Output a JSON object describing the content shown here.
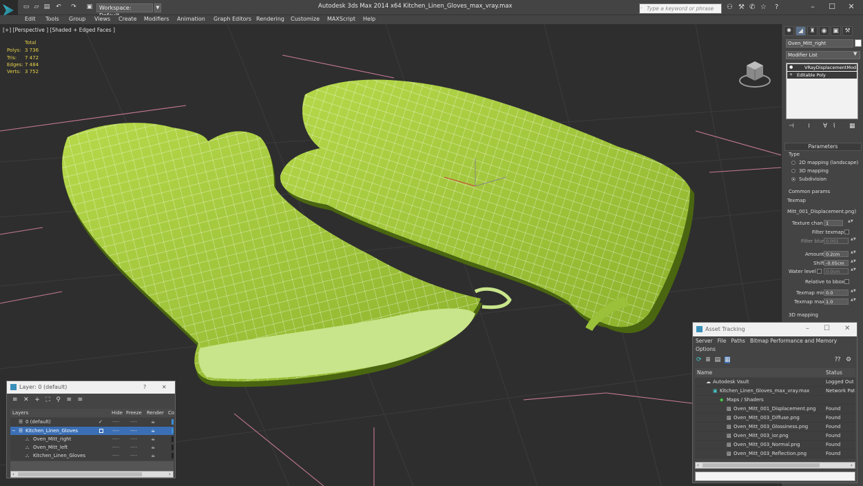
{
  "window": {
    "title": "Autodesk 3ds Max  2014 x64     Kitchen_Linen_Gloves_max_vray.max",
    "workspace_label": "Workspace: Default",
    "search_placeholder": "Type a keyword or phrase"
  },
  "menu": [
    "Edit",
    "Tools",
    "Group",
    "Views",
    "Create",
    "Modifiers",
    "Animation",
    "Graph Editors",
    "Rendering",
    "Customize",
    "MAXScript",
    "Help"
  ],
  "viewport": {
    "label": "[+] [Perspective ] [Shaded + Edged Faces ]",
    "stats_header": "Total",
    "stats": [
      {
        "name": "Polys:",
        "value": "3 736"
      },
      {
        "name": "Tris:",
        "value": "7 472"
      },
      {
        "name": "Edges:",
        "value": "7 484"
      },
      {
        "name": "Verts:",
        "value": "3 752"
      }
    ],
    "colors": {
      "mesh": "#9bc13a",
      "mesh_dark": "#5b7a14",
      "wire": "#ffffff",
      "grid_pink": "#c77a98",
      "grid": "#3d3d3d"
    }
  },
  "command_panel": {
    "object_name": "Oven_Mitt_right",
    "modifier_list_label": "Modifier List",
    "stack": [
      "VRayDisplacementMod",
      "Editable Poly"
    ],
    "parameters_title": "Parameters",
    "type_group": "Type",
    "type_options": [
      "2D mapping (landscape)",
      "3D mapping",
      "Subdivision"
    ],
    "type_selected": 2,
    "common_params_group": "Common params",
    "texmap_label": "Texmap",
    "texmap_value": "Mitt_001_Displacement.png)",
    "texture_chan_label": "Texture chan",
    "texture_chan_value": "1",
    "filter_texmap_label": "Filter texmap",
    "filter_blur_label": "Filter blur",
    "filter_blur_value": "0.001",
    "amount_label": "Amount",
    "amount_value": "0.2cm",
    "shift_label": "Shift",
    "shift_value": "-0.05cm",
    "water_level_label": "Water level",
    "water_level_value": "0.0cm",
    "relative_bbox_label": "Relative to bbox",
    "texmap_min_label": "Texmap min",
    "texmap_min_value": "0.0",
    "texmap_max_label": "Texmap max",
    "texmap_max_value": "1.0",
    "mapping_3d_group": "3D mapping"
  },
  "layer_dialog": {
    "title": "Layer: 0 (default)",
    "help": "?",
    "close": "✕",
    "columns": [
      "Layers",
      "Hide",
      "Freeze",
      "Render",
      "Co"
    ],
    "rows": [
      {
        "name": "0 (default)",
        "indent": 1,
        "selected": false
      },
      {
        "name": "Kitchen_Linen_Gloves",
        "indent": 1,
        "selected": true
      },
      {
        "name": "Oven_Mitt_right",
        "indent": 2,
        "selected": false
      },
      {
        "name": "Oven_Mitt_left",
        "indent": 2,
        "selected": false
      },
      {
        "name": "Kitchen_Linen_Gloves",
        "indent": 2,
        "selected": false
      }
    ],
    "hide_dash": "----",
    "freeze_dash": "----"
  },
  "asset_dialog": {
    "title": "Asset Tracking",
    "menu": [
      "Server",
      "File",
      "Paths",
      "Bitmap Performance and Memory",
      "Options"
    ],
    "col_name": "Name",
    "col_status": "Status",
    "rows": [
      {
        "name": "Autodesk Vault",
        "status": "Logged Out",
        "indent": 1
      },
      {
        "name": "Kitchen_Linen_Gloves_max_vray.max",
        "status": "Network Pat",
        "indent": 2
      },
      {
        "name": "Maps / Shaders",
        "status": "",
        "indent": 3
      },
      {
        "name": "Oven_Mitt_001_Displacement.png",
        "status": "Found",
        "indent": 4
      },
      {
        "name": "Oven_Mitt_003_Diffuse.png",
        "status": "Found",
        "indent": 4
      },
      {
        "name": "Oven_Mitt_003_Glossiness.png",
        "status": "Found",
        "indent": 4
      },
      {
        "name": "Oven_Mitt_003_ior.png",
        "status": "Found",
        "indent": 4
      },
      {
        "name": "Oven_Mitt_003_Normal.png",
        "status": "Found",
        "indent": 4
      },
      {
        "name": "Oven_Mitt_003_Reflection.png",
        "status": "Found",
        "indent": 4
      }
    ]
  }
}
